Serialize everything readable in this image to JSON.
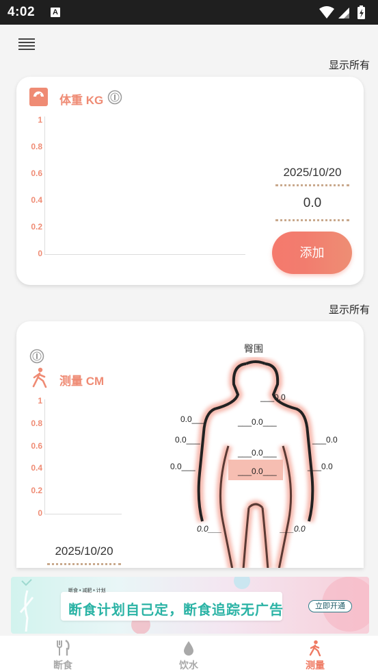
{
  "status_bar": {
    "time": "4:02",
    "notification_icon": "A"
  },
  "header": {
    "menu_icon": "hamburger-menu-icon"
  },
  "weight": {
    "show_all": "显示所有",
    "title": "体重 KG",
    "date": "2025/10/20",
    "value": "0.0",
    "add_label": "添加",
    "chart_data": {
      "type": "line",
      "ylabel": "",
      "yticks": [
        "1",
        "0.8",
        "0.6",
        "0.4",
        "0.2",
        "0"
      ],
      "ylim": [
        0,
        1
      ],
      "series": []
    }
  },
  "measure": {
    "show_all": "显示所有",
    "title": "测量 CM",
    "date": "2025/10/20",
    "body_title": "臀围",
    "labels": {
      "neck": "___0.0",
      "chest": "___0.0___",
      "left_shoulder": "0.0___",
      "right_arm": "___0.0",
      "left_arm": "0.0___",
      "waist_upper": "___0.0___",
      "left_forearm": "0.0___",
      "waist": "___0.0___",
      "right_forearm": "___0.0",
      "left_thigh": "0.0___",
      "right_thigh": "___0.0"
    },
    "chart_data": {
      "type": "line",
      "ylabel": "",
      "yticks": [
        "1",
        "0.8",
        "0.6",
        "0.4",
        "0.2",
        "0"
      ],
      "ylim": [
        0,
        1
      ],
      "series": []
    }
  },
  "ad": {
    "subtitle": "断食 • 减肥 • 计划",
    "text": "断食计划自己定，断食追踪无广告",
    "cta": "立即开通"
  },
  "tabs": [
    {
      "label": "断食",
      "icon": "fork-knife-icon",
      "active": false
    },
    {
      "label": "饮水",
      "icon": "water-drop-icon",
      "active": false
    },
    {
      "label": "测量",
      "icon": "walking-person-icon",
      "active": true
    }
  ],
  "colors": {
    "accent": "#ef8b74",
    "button": "#f57a6d"
  }
}
